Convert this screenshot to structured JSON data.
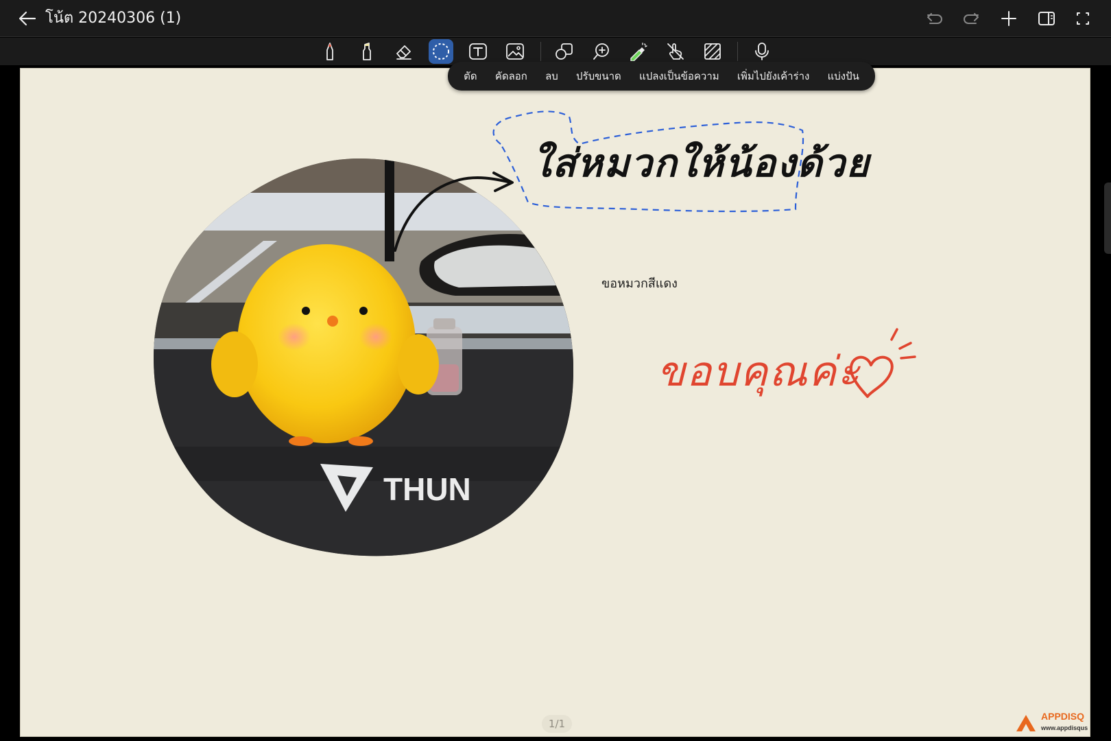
{
  "app": {
    "title": "โน้ต 20240306 (1)"
  },
  "context_menu": {
    "items": [
      "ตัด",
      "คัดลอก",
      "ลบ",
      "ปรับขนาด",
      "แปลงเป็นข้อความ",
      "เพิ่มไปยังเค้าร่าง",
      "แบ่งปัน"
    ]
  },
  "canvas": {
    "handwriting_top": "ใส่หมวกให้น้องด้วย",
    "typed_note": "ขอหมวกสีแดง",
    "handwriting_bottom": "ขอบคุณค่ะ",
    "photo_brand_text": "THUN",
    "page_indicator": "1/1"
  },
  "watermark": {
    "logo": "APPDISQ",
    "url": "www.appdisqus"
  },
  "colors": {
    "toolbar_bg": "#1b1b1b",
    "active_tool": "#2f5ea8",
    "canvas_bg": "#efebdc",
    "lasso_stroke": "#2c5fd8",
    "red_ink": "#e0452f"
  }
}
